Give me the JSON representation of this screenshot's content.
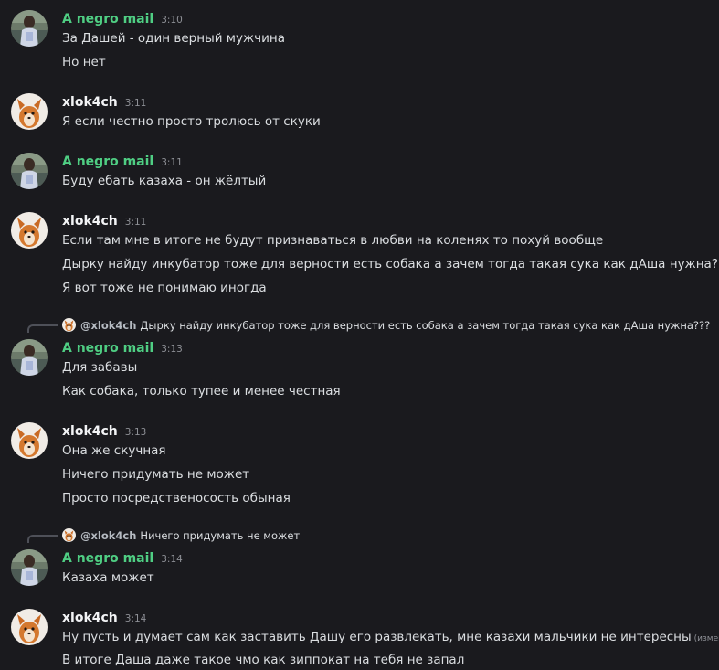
{
  "users": {
    "negro": {
      "name": "A negro mail",
      "color": "#4fce83"
    },
    "xlok": {
      "name": "xlok4ch",
      "color": "#f2f3f5"
    }
  },
  "messages": [
    {
      "author": "A negro mail",
      "time": "3:10",
      "lines": [
        "За Дашей - один верный мужчина",
        "Но нет"
      ]
    },
    {
      "author": "xlok4ch",
      "time": "3:11",
      "lines": [
        "Я если честно просто тролюсь от скуки"
      ]
    },
    {
      "author": "A negro mail",
      "time": "3:11",
      "lines": [
        "Буду ебать казаха - он жёлтый"
      ]
    },
    {
      "author": "xlok4ch",
      "time": "3:11",
      "lines": [
        "Если там мне в итоге не будут признаваться в любви на коленях то похуй вообще",
        "Дырку найду инкубатор тоже для верности есть собака а зачем тогда такая сука как дАша нужна???",
        "Я вот тоже не понимаю иногда"
      ]
    },
    {
      "reply": {
        "author": "@xlok4ch",
        "text": "Дырку найду инкубатор тоже для верности есть собака а зачем тогда такая сука как дАша нужна???"
      },
      "author": "A negro mail",
      "time": "3:13",
      "lines": [
        "Для забавы",
        "Как собака, только тупее и менее честная"
      ]
    },
    {
      "author": "xlok4ch",
      "time": "3:13",
      "lines": [
        "Она же скучная",
        "Ничего придумать не может",
        "Просто посредственосость обыная"
      ]
    },
    {
      "reply": {
        "author": "@xlok4ch",
        "text": "Ничего придумать не может"
      },
      "author": "A negro mail",
      "time": "3:14",
      "lines": [
        "Казаха может"
      ]
    },
    {
      "author": "xlok4ch",
      "time": "3:14",
      "lines": [
        "Ну пусть и думает сам как заставить Дашу его развлекать, мне казахи мальчики не интересны",
        "В итоге Даша даже такое чмо как зиппокат на тебя не запал"
      ],
      "edited": "(изменено)"
    }
  ]
}
